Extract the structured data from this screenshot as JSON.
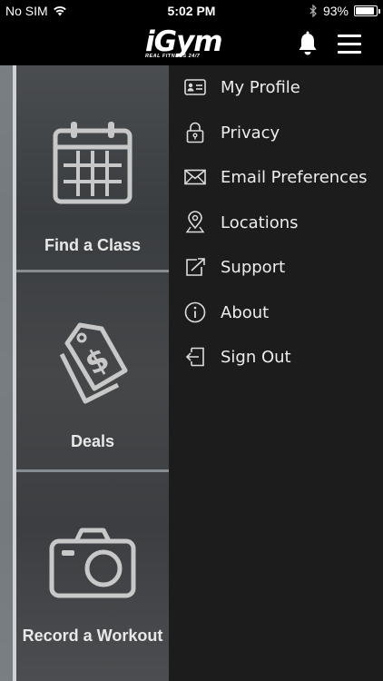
{
  "status_bar": {
    "carrier": "No SIM",
    "time": "5:02 PM",
    "battery_percent": "93%",
    "battery_level": 0.93,
    "icons": [
      "wifi-icon",
      "bluetooth-icon",
      "battery-icon"
    ]
  },
  "header": {
    "logo_text": "iGym",
    "logo_subtext": "REAL FITNESS 24/7",
    "icons": [
      "bell-icon",
      "hamburger-menu-icon"
    ]
  },
  "background_tiles": [
    {
      "label": "Find a Class",
      "icon": "calendar-icon"
    },
    {
      "label": "Deals",
      "icon": "price-tag-icon"
    },
    {
      "label": "Record a Workout",
      "icon": "camera-icon"
    }
  ],
  "menu": {
    "items": [
      {
        "label": "My Profile",
        "icon": "id-card-icon"
      },
      {
        "label": "Privacy",
        "icon": "lock-icon"
      },
      {
        "label": "Email Preferences",
        "icon": "envelope-icon"
      },
      {
        "label": "Locations",
        "icon": "location-pin-icon"
      },
      {
        "label": "Support",
        "icon": "external-link-icon"
      },
      {
        "label": "About",
        "icon": "info-icon"
      },
      {
        "label": "Sign Out",
        "icon": "sign-out-icon"
      }
    ]
  },
  "colors": {
    "drawer_bg": "#1c1c1c",
    "bar_bg": "#000000",
    "text": "#ededed"
  }
}
